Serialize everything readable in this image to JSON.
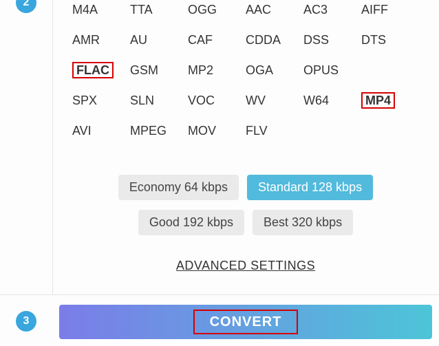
{
  "steps": {
    "two": "2",
    "three": "3"
  },
  "formats": {
    "row1": [
      "M4A",
      "TTA",
      "OGG",
      "AAC",
      "AC3",
      "AIFF"
    ],
    "row2": [
      "AMR",
      "AU",
      "CAF",
      "CDDA",
      "DSS",
      "DTS"
    ],
    "row3": [
      "FLAC",
      "GSM",
      "MP2",
      "OGA",
      "OPUS"
    ],
    "row4": [
      "SPX",
      "SLN",
      "VOC",
      "WV",
      "W64",
      "MP4"
    ],
    "row5": [
      "AVI",
      "MPEG",
      "MOV",
      "FLV"
    ]
  },
  "quality": {
    "economy": "Economy 64 kbps",
    "standard": "Standard 128 kbps",
    "good": "Good 192 kbps",
    "best": "Best 320 kbps"
  },
  "advanced": "ADVANCED SETTINGS",
  "convert": "CONVERT",
  "highlighted": [
    "FLAC",
    "MP4"
  ]
}
